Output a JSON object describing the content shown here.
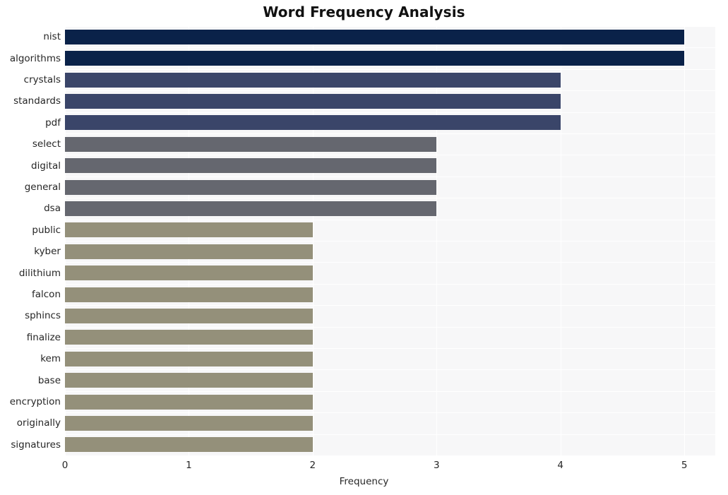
{
  "chart_data": {
    "type": "bar",
    "orientation": "horizontal",
    "title": "Word Frequency Analysis",
    "xlabel": "Frequency",
    "ylabel": "",
    "xlim": [
      0,
      5.25
    ],
    "xticks": [
      "0",
      "1",
      "2",
      "3",
      "4",
      "5"
    ],
    "xtick_values": [
      0,
      1,
      2,
      3,
      4,
      5
    ],
    "grid": true,
    "legend": null,
    "categories": [
      "nist",
      "algorithms",
      "crystals",
      "standards",
      "pdf",
      "select",
      "digital",
      "general",
      "dsa",
      "public",
      "kyber",
      "dilithium",
      "falcon",
      "sphincs",
      "finalize",
      "kem",
      "base",
      "encryption",
      "originally",
      "signatures"
    ],
    "values": [
      5,
      5,
      4,
      4,
      4,
      3,
      3,
      3,
      3,
      2,
      2,
      2,
      2,
      2,
      2,
      2,
      2,
      2,
      2,
      2
    ],
    "bar_colors": [
      "#0a2249",
      "#0a2249",
      "#3a4569",
      "#3a4569",
      "#3a4569",
      "#65676f",
      "#65676f",
      "#65676f",
      "#65676f",
      "#94907a",
      "#94907a",
      "#94907a",
      "#94907a",
      "#94907a",
      "#94907a",
      "#94907a",
      "#94907a",
      "#94907a",
      "#94907a",
      "#94907a"
    ]
  },
  "style": {
    "plot_background": "#f7f7f8",
    "figure_background": "#ffffff",
    "gridline_color": "#ffffff",
    "text_color": "#262626",
    "title_color": "#111111"
  }
}
